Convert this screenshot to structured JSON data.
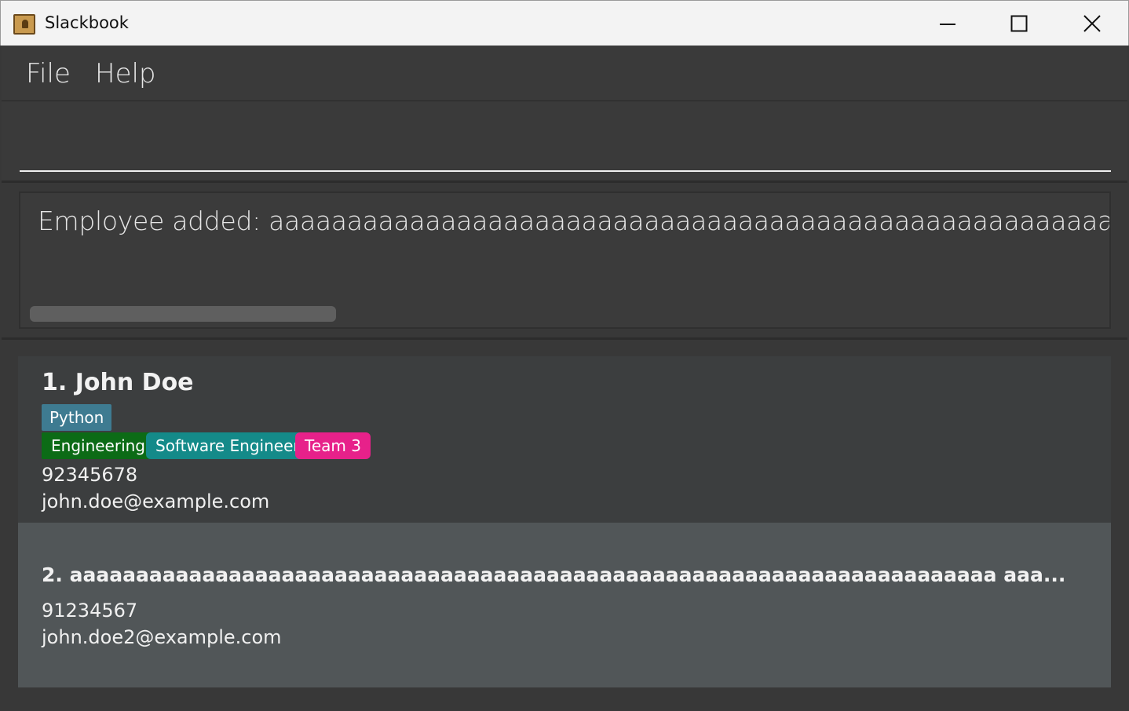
{
  "window": {
    "title": "Slackbook"
  },
  "menu": {
    "file_label": "File",
    "help_label": "Help"
  },
  "command_box": {
    "value": ""
  },
  "result_display": {
    "text": "Employee added: aaaaaaaaaaaaaaaaaaaaaaaaaaaaaaaaaaaaaaaaaaaaaaaaaaaaaaaaaaaaaaaaaaaaaaaaaaaaaaaaaaaaaaaaaaaaaaaaaaaaaaaaaaaaaaaa"
  },
  "employees": [
    {
      "index": "1.",
      "name": "John Doe",
      "skill_tags": [
        "Python"
      ],
      "role_tags": [
        {
          "label": "Engineering",
          "color": "#0c6b16"
        },
        {
          "label": "Software Engineer",
          "color": "#148a89"
        },
        {
          "label": "Team 3",
          "color": "#e7218a"
        }
      ],
      "phone": "92345678",
      "email": "john.doe@example.com"
    },
    {
      "index": "2.",
      "name": "aaaaaaaaaaaaaaaaaaaaaaaaaaaaaaaaaaaaaaaaaaaaaaaaaaaaaaaaaaaaaaaaaaaaaa aaa...",
      "phone": "91234567",
      "email": "john.doe2@example.com"
    }
  ],
  "colors": {
    "skill_tag": "#3e7b91"
  }
}
